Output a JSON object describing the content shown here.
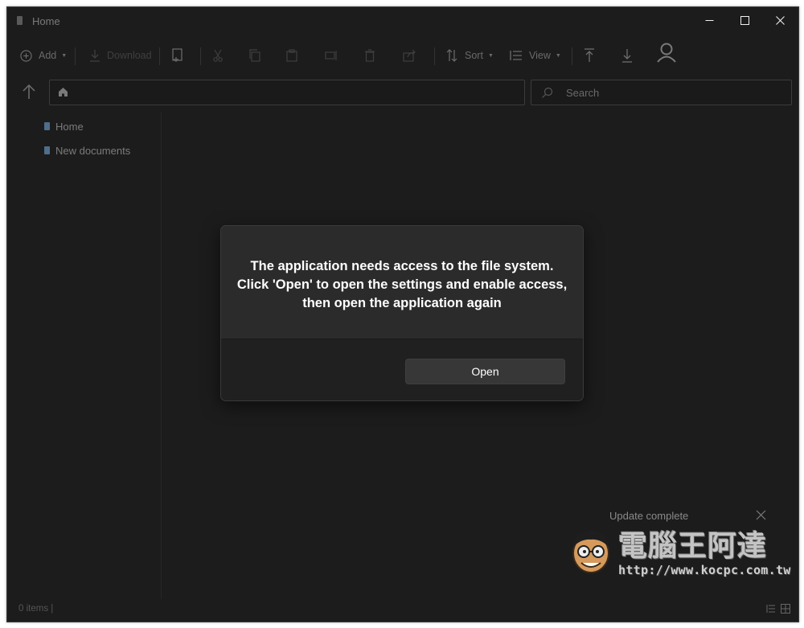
{
  "window": {
    "title": "Home",
    "controls": {
      "minimize": "minimize-icon",
      "maximize": "maximize-icon",
      "close": "close-icon"
    }
  },
  "toolbar": {
    "add_label": "Add",
    "download_label": "Download",
    "sort_label": "Sort",
    "view_label": "View"
  },
  "address": {
    "location_icon": "home-icon"
  },
  "search": {
    "placeholder": "Search"
  },
  "sidebar": {
    "items": [
      {
        "label": "Home"
      },
      {
        "label": "New documents"
      }
    ]
  },
  "dialog": {
    "lines": [
      "The application needs access to the file system.",
      "Click 'Open' to open the settings and enable access,",
      "then open the application again"
    ],
    "button_label": "Open"
  },
  "status": {
    "items_count": "0 items |"
  },
  "toast": {
    "title": "Update complete"
  },
  "watermark": {
    "chinese_text": "電腦王阿達",
    "url": "http://www.kocpc.com.tw"
  },
  "colors": {
    "window_bg": "#1c1c1c",
    "dialog_bg": "#2b2b2b",
    "dialog_footer_bg": "#202020",
    "button_bg": "#373737",
    "text_primary": "#ffffff",
    "text_muted": "#7a7a7a"
  }
}
